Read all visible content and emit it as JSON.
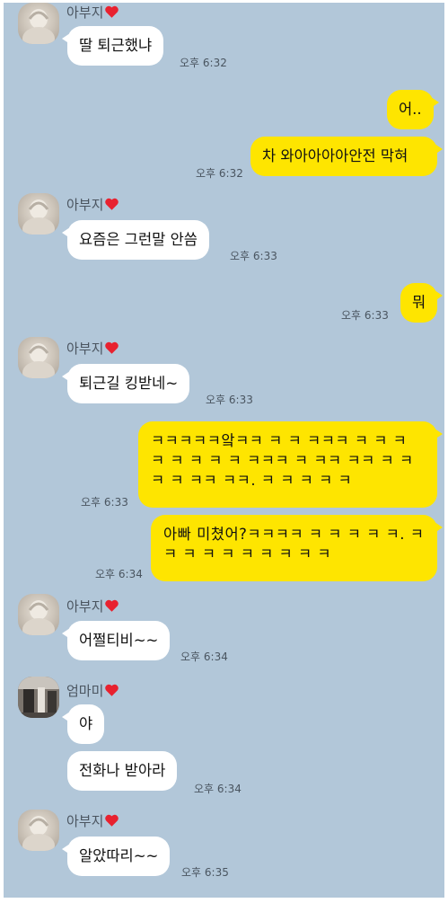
{
  "messages": [
    {
      "sender": "아부지",
      "text": "딸 퇴근했냐",
      "time": "오후 6:32"
    },
    {
      "text": "어..",
      "from": "me"
    },
    {
      "text": "차 와아아아아안전 막혀",
      "time": "오후 6:32",
      "from": "me"
    },
    {
      "sender": "아부지",
      "text": "요즘은 그런말 안씀",
      "time": "오후 6:33"
    },
    {
      "text": "뭐",
      "time": "오후 6:33",
      "from": "me"
    },
    {
      "sender": "아부지",
      "text": "퇴근길 킹받네~",
      "time": "오후 6:33"
    },
    {
      "text": "ㅋㅋㅋㅋㅋ앜ㅋㅋ ㅋ ㅋ ㅋㅋㅋ ㅋ ㅋ ㅋ ㅋ ㅋ ㅋ ㅋ ㅋ ㅋㅋㅋ ㅋ ㅋㅋ ㅋㅋ ㅋ ㅋ ㅋ ㅋ ㅋㅋ ㅋㅋ. ㅋ ㅋ ㅋ ㅋ ㅋ",
      "time": "오후 6:33",
      "from": "me"
    },
    {
      "text": "아빠 미쳤어?ㅋㅋㅋㅋ ㅋ ㅋ ㅋ ㅋ ㅋ. ㅋ ㅋ ㅋ ㅋ ㅋ ㅋ ㅋ ㅋ ㅋ ㅋ",
      "time": "오후 6:34",
      "from": "me"
    },
    {
      "sender": "아부지",
      "text": "어쩔티비~~",
      "time": "오후 6:34"
    },
    {
      "sender": "엄마미",
      "text": "야"
    },
    {
      "text": "전화나 받아라",
      "time": "오후 6:34"
    },
    {
      "sender": "아부지",
      "text": "알았따리~~",
      "time": "오후 6:35"
    }
  ],
  "colors": {
    "background": "#b2c7d9",
    "my_bubble": "#fee500",
    "their_bubble": "#ffffff",
    "heart": "#e8212f"
  },
  "icons": [
    "heart-icon",
    "dad-avatar",
    "mom-avatar"
  ]
}
